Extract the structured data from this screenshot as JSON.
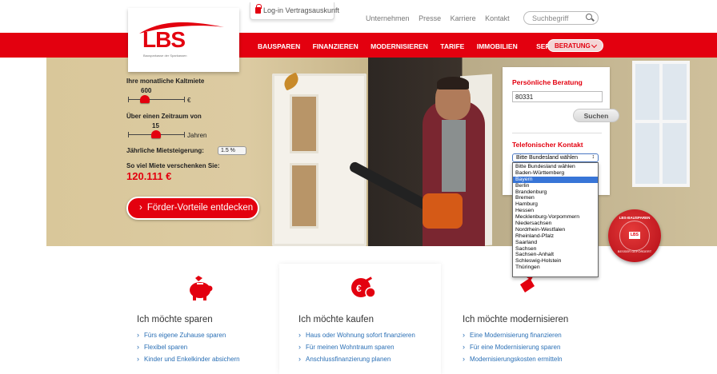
{
  "topbar": {
    "login_label": "Log-in Vertragsauskunft",
    "links": [
      "Unternehmen",
      "Presse",
      "Karriere",
      "Kontakt"
    ],
    "search_placeholder": "Suchbegriff"
  },
  "logo": {
    "text": "LBS",
    "subtitle": "Bausparkasse der Sparkassen"
  },
  "nav": {
    "items": [
      "BAUSPAREN",
      "FINANZIEREN",
      "MODERNISIEREN",
      "TARIFE",
      "IMMOBILIEN"
    ],
    "service": "SERVICE",
    "beratung": "BERATUNG"
  },
  "calculator": {
    "rent_label": "Ihre monatliche Kaltmiete",
    "rent_value": "600",
    "rent_unit": "€",
    "rent_level": 0.3,
    "period_label": "Über einen Zeitraum von",
    "period_value": "15",
    "period_unit": "Jahren",
    "period_level": 0.5,
    "increase_label": "Jährliche Mietsteigerung:",
    "increase_value": "1.5 %",
    "result_label": "So viel Miete verschenken Sie:",
    "result_value": "120.111 €",
    "cta_label": "Förder-Vorteile entdecken"
  },
  "beratung_panel": {
    "title": "Persönliche Beratung",
    "zip_value": "80331",
    "search_button": "Suchen",
    "phone_title": "Telefonischer Kontakt",
    "bundesland_select": "Bitte Bundesland wählen",
    "bundesland_options": [
      "Bitte Bundesland wählen",
      "Baden-Württemberg",
      "Bayern",
      "Berlin",
      "Brandenburg",
      "Bremen",
      "Hamburg",
      "Hessen",
      "Mecklenburg-Vorpommern",
      "Niedersachsen",
      "Nordrhein-Westfalen",
      "Rheinland-Pfalz",
      "Saarland",
      "Sachsen",
      "Sachsen-Anhalt",
      "Schleswig-Holstein",
      "Thüringen"
    ],
    "selected_option": "Bayern"
  },
  "seal": {
    "top": "LBS-BAUSPAREN",
    "bottom": "BESSER GEFÖRDERT",
    "logo": "LBS"
  },
  "cards": [
    {
      "title": "Ich möchte sparen",
      "icon": "piggy-bank-icon",
      "links": [
        "Fürs eigene Zuhause sparen",
        "Flexibel sparen",
        "Kinder und Enkelkinder absichern"
      ]
    },
    {
      "title": "Ich möchte kaufen",
      "icon": "coin-key-icon",
      "links": [
        "Haus oder Wohnung sofort finanzieren",
        "Für meinen Wohntraum sparen",
        "Anschlussfinanzierung planen"
      ]
    },
    {
      "title": "Ich möchte modernisieren",
      "icon": "paint-brush-icon",
      "links": [
        "Eine Modernisierung finanzieren",
        "Für eine Modernisierung sparen",
        "Modernisierungskosten ermitteln"
      ]
    }
  ],
  "colors": {
    "brand_red": "#e3000f",
    "link_blue": "#2a6fb5",
    "select_blue": "#3875d7"
  }
}
